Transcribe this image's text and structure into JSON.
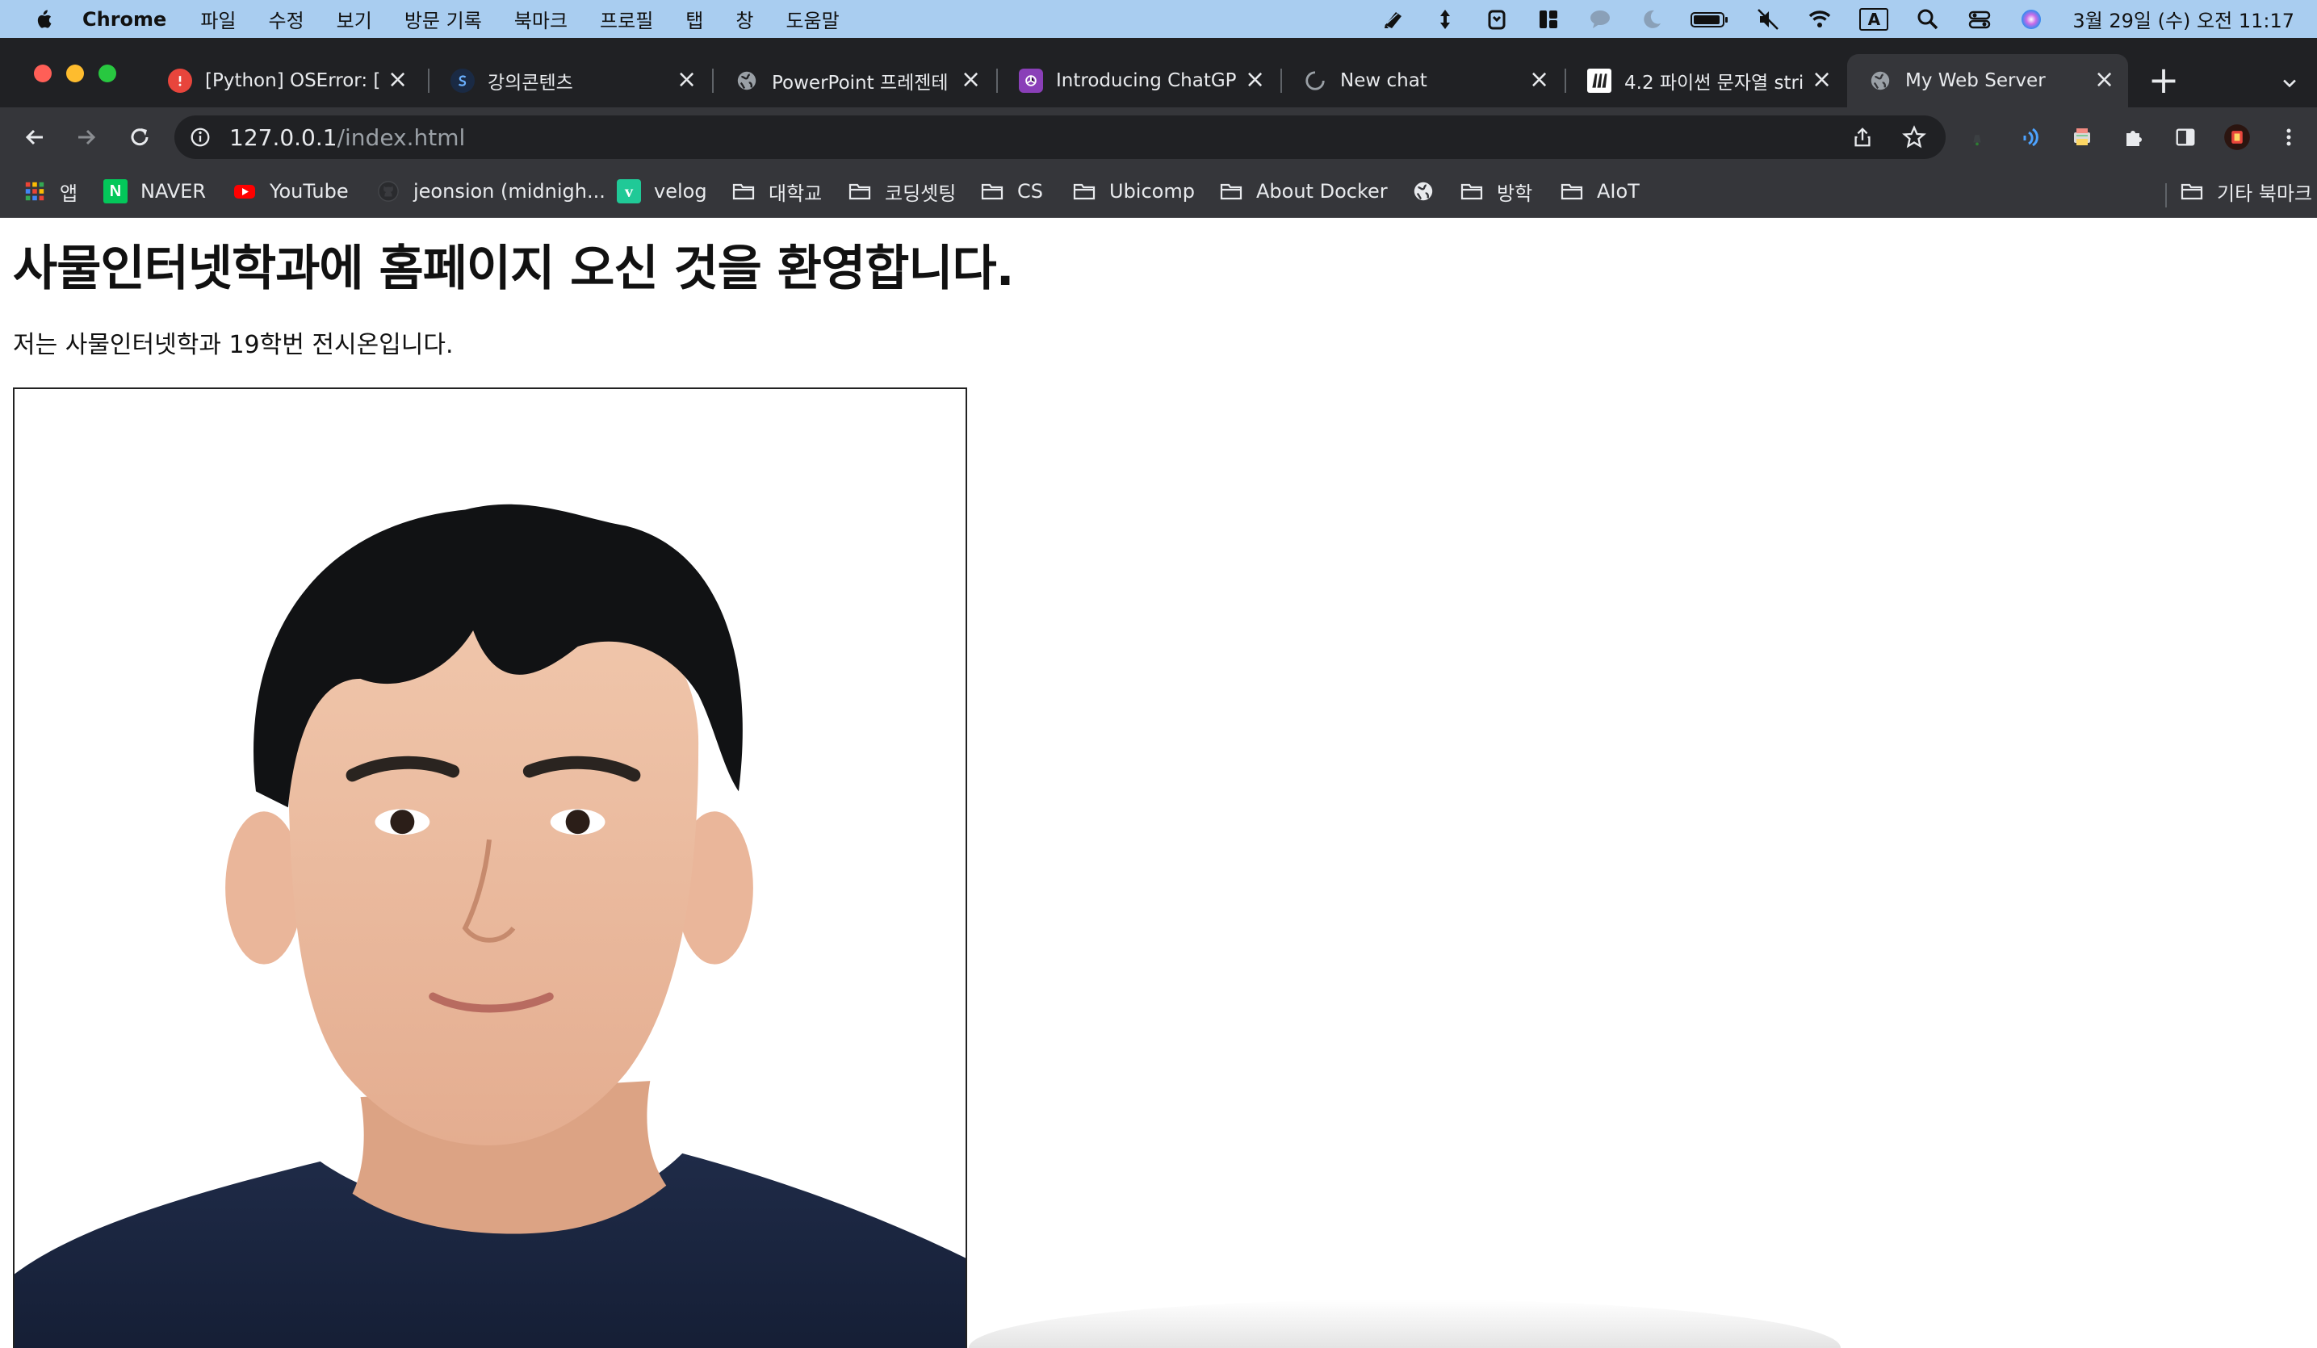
{
  "menubar": {
    "app_name": "Chrome",
    "items": [
      "파일",
      "수정",
      "보기",
      "방문 기록",
      "북마크",
      "프로필",
      "탭",
      "창",
      "도움말"
    ],
    "status_icons": [
      "pen-icon",
      "arrows-icon",
      "clipboard-icon",
      "layout-icon",
      "chat-icon",
      "moon-icon",
      "battery-icon",
      "mute-icon",
      "wifi-icon",
      "input-source-icon",
      "search-icon",
      "control-center-icon",
      "siri-icon"
    ],
    "input_source_label": "A",
    "clock": "3월 29일 (수) 오전 11:17"
  },
  "tabs": [
    {
      "title": "[Python] OSError: [",
      "favicon": "python-error-icon",
      "favicon_color": "#e8453c",
      "active": false
    },
    {
      "title": "강의콘텐츠",
      "favicon": "lms-icon",
      "favicon_color": "#1a2a44",
      "active": false
    },
    {
      "title": "PowerPoint 프레젠테",
      "favicon": "globe-icon",
      "favicon_color": "#9aa0a6",
      "active": false
    },
    {
      "title": "Introducing ChatGP",
      "favicon": "openai-icon",
      "favicon_color": "#8a3fb8",
      "active": false
    },
    {
      "title": "New chat",
      "favicon": "loading-icon",
      "favicon_color": "#9aa0a6",
      "active": false
    },
    {
      "title": "4.2 파이썬 문자열 stri",
      "favicon": "book-icon",
      "favicon_color": "#ffffff",
      "active": false
    },
    {
      "title": "My Web Server",
      "favicon": "globe-icon",
      "favicon_color": "#9aa0a6",
      "active": true
    }
  ],
  "toolbar": {
    "url_host": "127.0.0.1",
    "url_path": "/index.html"
  },
  "bookmarks": [
    {
      "label": "앱",
      "icon": "apps-grid-icon"
    },
    {
      "label": "NAVER",
      "icon": "naver-icon"
    },
    {
      "label": "YouTube",
      "icon": "youtube-icon"
    },
    {
      "label": "jeonsion (midnigh...",
      "icon": "github-icon"
    },
    {
      "label": "velog",
      "icon": "velog-icon"
    },
    {
      "label": "대학교",
      "icon": "folder-icon"
    },
    {
      "label": "코딩셋팅",
      "icon": "folder-icon"
    },
    {
      "label": "CS",
      "icon": "folder-icon"
    },
    {
      "label": "Ubicomp",
      "icon": "folder-icon"
    },
    {
      "label": "About Docker",
      "icon": "folder-icon"
    },
    {
      "label": "",
      "icon": "globe-icon"
    },
    {
      "label": "방학",
      "icon": "folder-icon"
    },
    {
      "label": "AIoT",
      "icon": "folder-icon"
    },
    {
      "label": "기타 북마크",
      "icon": "folder-icon"
    }
  ],
  "page": {
    "heading": "사물인터넷학과에 홈페이지 오신 것을 환영합니다.",
    "paragraph": "저는 사물인터넷학과 19학번 전시온입니다."
  },
  "colors": {
    "menubar_bg": "#a9cdf0",
    "tabstrip_bg": "#202124",
    "toolbar_bg": "#35363a",
    "omnibox_bg": "#202124",
    "traffic_red": "#ff5f57",
    "traffic_yellow": "#febc2e",
    "traffic_green": "#28c840"
  }
}
